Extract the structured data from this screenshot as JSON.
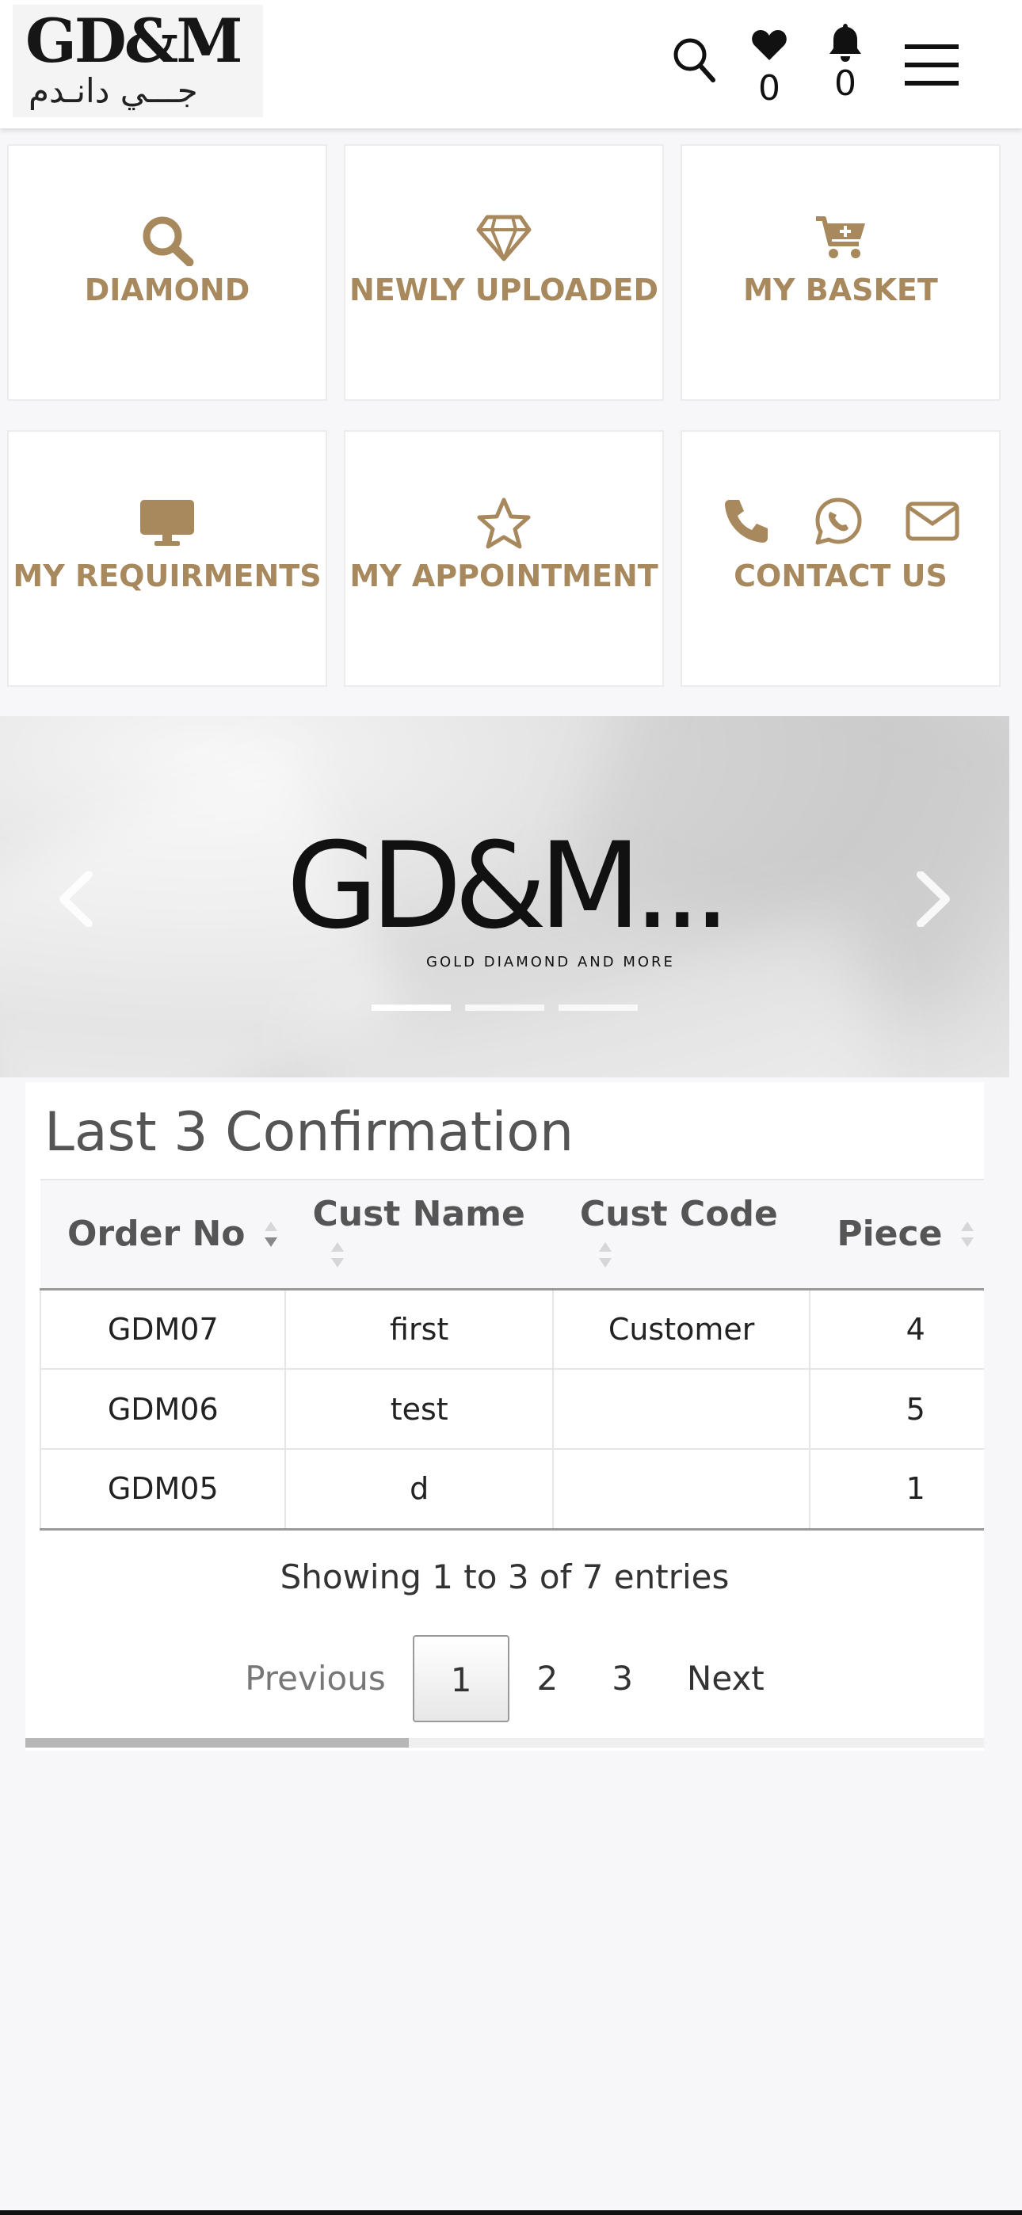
{
  "header": {
    "logo_text": "GD&M",
    "logo_arabic": "جـــي دانـدم",
    "wishlist_count": "0",
    "notifications_count": "0"
  },
  "tiles": [
    {
      "label": "DIAMOND",
      "icon": "search-icon"
    },
    {
      "label": "NEWLY UPLOADED",
      "icon": "diamond-icon"
    },
    {
      "label": "MY BASKET",
      "icon": "cart-plus-icon"
    },
    {
      "label": "MY REQUIRMENTS",
      "icon": "desktop-icon"
    },
    {
      "label": "MY APPOINTMENT",
      "icon": "star-icon"
    },
    {
      "label": "CONTACT US",
      "icons": [
        "phone-icon",
        "whatsapp-icon",
        "envelope-icon"
      ]
    }
  ],
  "carousel": {
    "logo_text": "GD&M...",
    "tagline": "GOLD DIAMOND AND MORE",
    "slides": 3,
    "active_slide": 1
  },
  "confirmation": {
    "title": "Last 3 Confirmation",
    "columns": [
      "Order No",
      "Cust Name",
      "Cust Code",
      "Piece"
    ],
    "rows": [
      {
        "order_no": "GDM07",
        "cust_name": "first",
        "cust_code": "Customer",
        "piece": "4"
      },
      {
        "order_no": "GDM06",
        "cust_name": "test",
        "cust_code": "",
        "piece": "5"
      },
      {
        "order_no": "GDM05",
        "cust_name": "d",
        "cust_code": "",
        "piece": "1"
      }
    ],
    "info": "Showing 1 to 3 of 7 entries",
    "pagination": {
      "previous": "Previous",
      "pages": [
        "1",
        "2",
        "3"
      ],
      "current": "1",
      "next": "Next"
    }
  },
  "colors": {
    "accent": "#a8895d",
    "background": "#f7f6f9"
  }
}
